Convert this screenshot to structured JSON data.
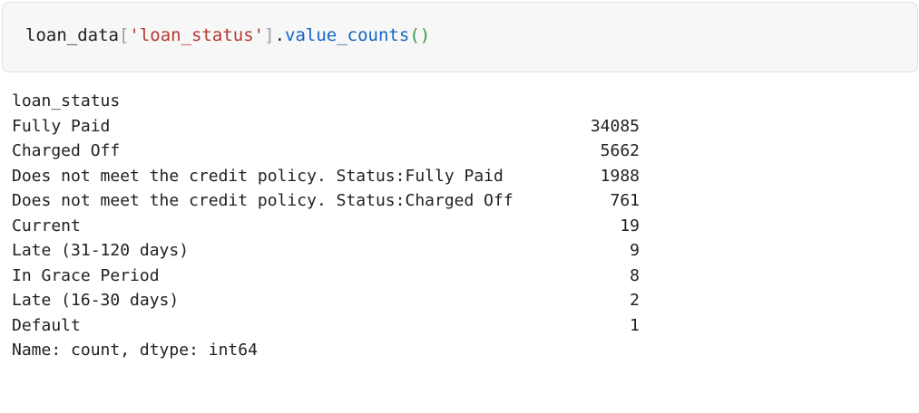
{
  "code_cell": {
    "tokens": {
      "var": "loan_data",
      "bracket_open": "[",
      "string": "'loan_status'",
      "bracket_close": "]",
      "dot": ".",
      "method": "value_counts",
      "paren_open": "(",
      "paren_close": ")"
    }
  },
  "output": {
    "header": "loan_status",
    "rows": [
      {
        "label": "Fully Paid",
        "value": "34085"
      },
      {
        "label": "Charged Off",
        "value": "5662"
      },
      {
        "label": "Does not meet the credit policy. Status:Fully Paid",
        "value": "1988"
      },
      {
        "label": "Does not meet the credit policy. Status:Charged Off",
        "value": "761"
      },
      {
        "label": "Current",
        "value": "19"
      },
      {
        "label": "Late (31-120 days)",
        "value": "9"
      },
      {
        "label": "In Grace Period",
        "value": "8"
      },
      {
        "label": "Late (16-30 days)",
        "value": "2"
      },
      {
        "label": "Default",
        "value": "1"
      }
    ],
    "footer": "Name: count, dtype: int64"
  }
}
